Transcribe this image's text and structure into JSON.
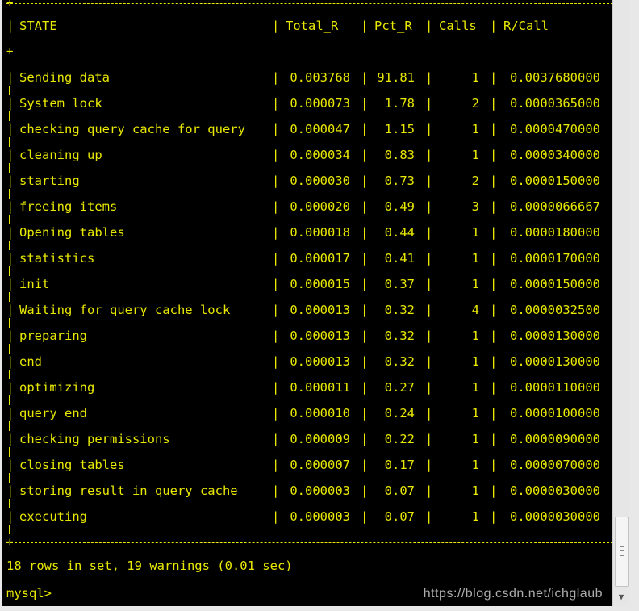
{
  "table": {
    "headers": [
      "STATE",
      "Total_R",
      "Pct_R",
      "Calls",
      "R/Call"
    ],
    "rows": [
      [
        "Sending data",
        "0.003768",
        "91.81",
        "1",
        "0.0037680000"
      ],
      [
        "System lock",
        "0.000073",
        "1.78",
        "2",
        "0.0000365000"
      ],
      [
        "checking query cache for query",
        "0.000047",
        "1.15",
        "1",
        "0.0000470000"
      ],
      [
        "cleaning up",
        "0.000034",
        "0.83",
        "1",
        "0.0000340000"
      ],
      [
        "starting",
        "0.000030",
        "0.73",
        "2",
        "0.0000150000"
      ],
      [
        "freeing items",
        "0.000020",
        "0.49",
        "3",
        "0.0000066667"
      ],
      [
        "Opening tables",
        "0.000018",
        "0.44",
        "1",
        "0.0000180000"
      ],
      [
        "statistics",
        "0.000017",
        "0.41",
        "1",
        "0.0000170000"
      ],
      [
        "init",
        "0.000015",
        "0.37",
        "1",
        "0.0000150000"
      ],
      [
        "Waiting for query cache lock",
        "0.000013",
        "0.32",
        "4",
        "0.0000032500"
      ],
      [
        "preparing",
        "0.000013",
        "0.32",
        "1",
        "0.0000130000"
      ],
      [
        "end",
        "0.000013",
        "0.32",
        "1",
        "0.0000130000"
      ],
      [
        "optimizing",
        "0.000011",
        "0.27",
        "1",
        "0.0000110000"
      ],
      [
        "query end",
        "0.000010",
        "0.24",
        "1",
        "0.0000100000"
      ],
      [
        "checking permissions",
        "0.000009",
        "0.22",
        "1",
        "0.0000090000"
      ],
      [
        "closing tables",
        "0.000007",
        "0.17",
        "1",
        "0.0000070000"
      ],
      [
        "storing result in query cache",
        "0.000003",
        "0.07",
        "1",
        "0.0000030000"
      ],
      [
        "executing",
        "0.000003",
        "0.07",
        "1",
        "0.0000030000"
      ]
    ]
  },
  "footer": "18 rows in set, 19 warnings (0.01 sec)",
  "prompt": "mysql>",
  "watermark": "https://blog.csdn.net/ichglaub",
  "colors": {
    "terminal_bg": "#000000",
    "terminal_text": "#e8e800"
  }
}
